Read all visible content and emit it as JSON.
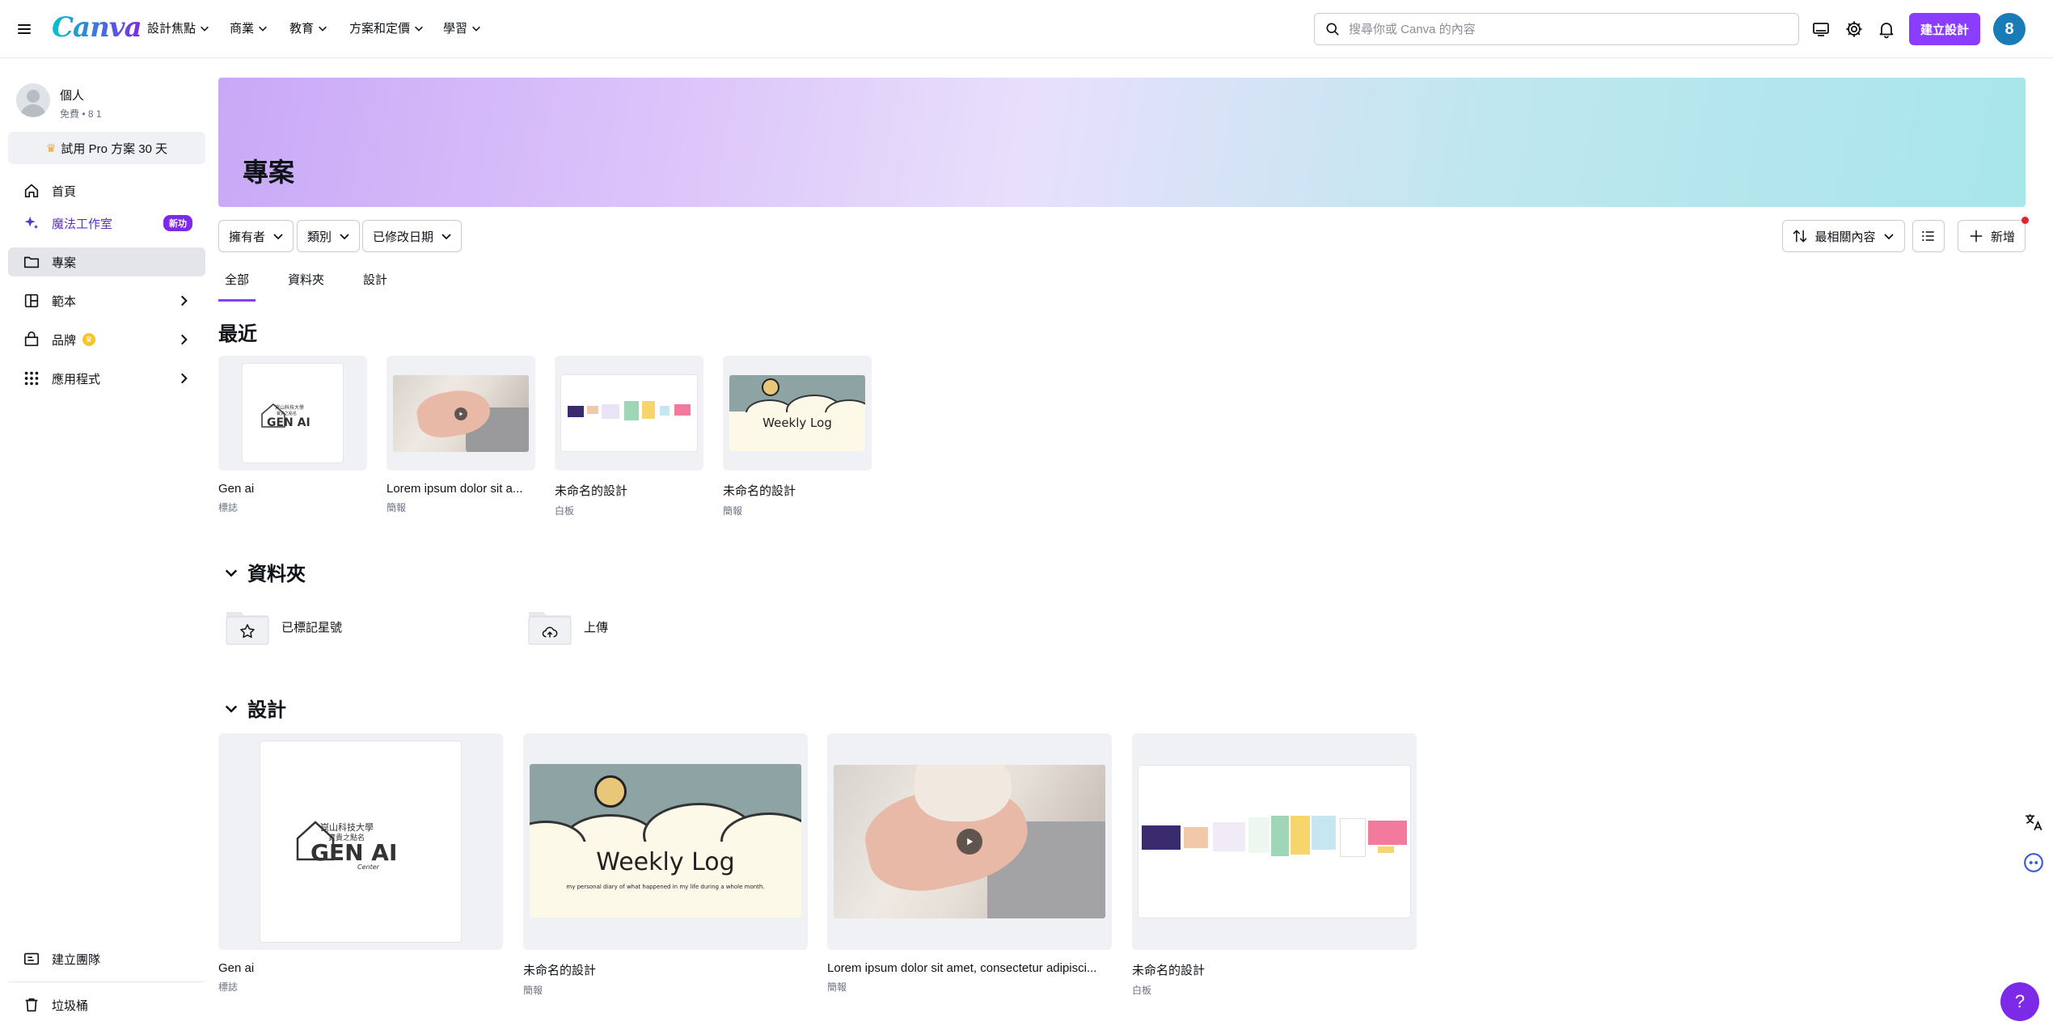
{
  "header": {
    "logo": "Canva",
    "nav": [
      "設計焦點",
      "商業",
      "教育",
      "方案和定價",
      "學習"
    ],
    "search_placeholder": "搜尋你或 Canva 的內容",
    "create_button": "建立設計",
    "avatar_initial": "8"
  },
  "sidebar": {
    "profile_name": "個人",
    "profile_sub": "免費 • 8 1",
    "trial_label": "試用 Pro 方案 30 天",
    "items": [
      {
        "label": "首頁"
      },
      {
        "label": "魔法工作室",
        "badge": "新功"
      },
      {
        "label": "專案"
      },
      {
        "label": "範本"
      },
      {
        "label": "品牌"
      },
      {
        "label": "應用程式"
      }
    ],
    "bottom": [
      {
        "label": "建立團隊"
      },
      {
        "label": "垃圾桶"
      }
    ]
  },
  "main": {
    "title": "專案",
    "filters": [
      "擁有者",
      "類別",
      "已修改日期"
    ],
    "sort_label": "最相關內容",
    "new_label": "新增",
    "tabs": [
      "全部",
      "資料夾",
      "設計"
    ],
    "recent_heading": "最近",
    "recent": [
      {
        "title": "Gen ai",
        "type": "標誌"
      },
      {
        "title": "Lorem ipsum dolor sit a...",
        "type": "簡報"
      },
      {
        "title": "未命名的設計",
        "type": "白板"
      },
      {
        "title": "未命名的設計",
        "type": "簡報"
      }
    ],
    "folders_heading": "資料夾",
    "folders": [
      {
        "label": "已標記星號"
      },
      {
        "label": "上傳"
      }
    ],
    "designs_heading": "設計",
    "designs": [
      {
        "title": "Gen ai",
        "type": "標誌"
      },
      {
        "title": "未命名的設計",
        "type": "簡報"
      },
      {
        "title": "Lorem ipsum dolor sit amet, consectetur adipisci...",
        "type": "簡報"
      },
      {
        "title": "未命名的設計",
        "type": "白板"
      }
    ],
    "thumb_text": {
      "genai_line1": "崑山科技大學",
      "genai_line2": "寶貴之點名",
      "genai_logo": "GEN AI",
      "genai_center": "Center",
      "weekly_title": "Weekly Log",
      "weekly_sub": "my personal diary of what happened in my life during a whole month."
    }
  },
  "fab": {
    "help": "?"
  }
}
